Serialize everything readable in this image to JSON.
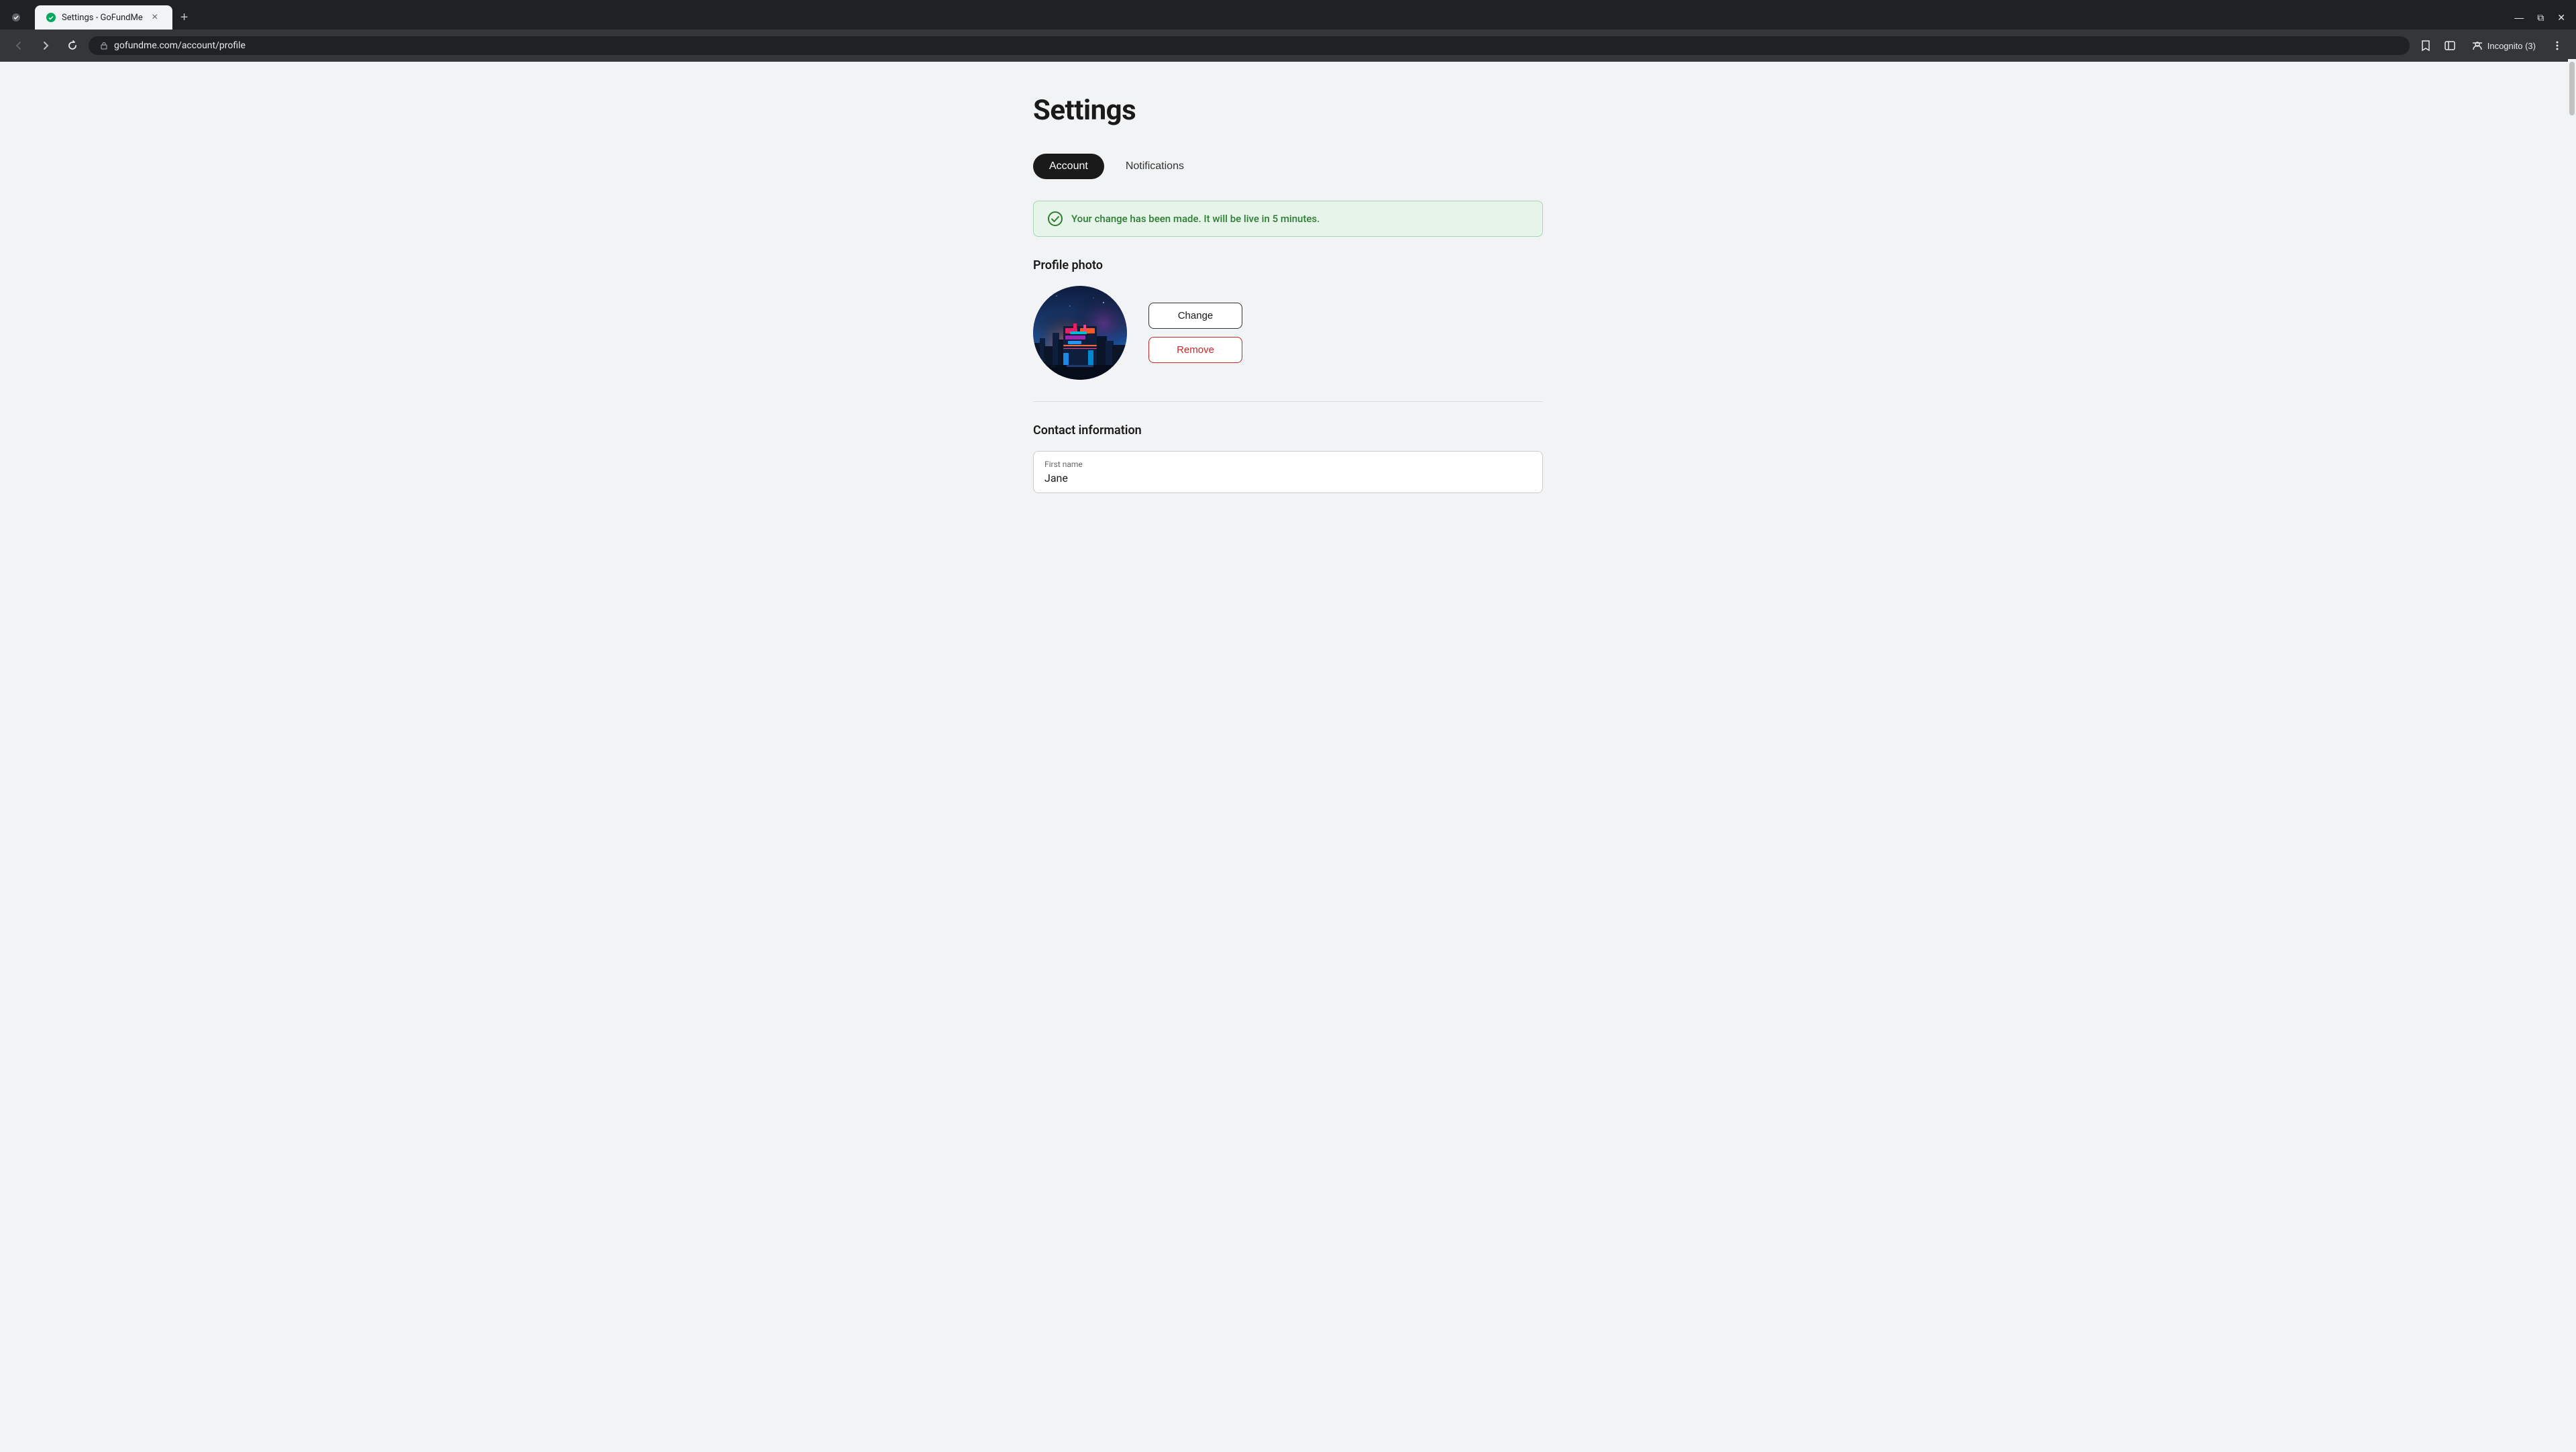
{
  "browser": {
    "tab": {
      "title": "Settings - GoFundMe",
      "favicon": "gfm"
    },
    "new_tab_label": "+",
    "address_bar": {
      "url": "gofundme.com/account/profile"
    },
    "incognito": {
      "label": "Incognito (3)"
    },
    "nav": {
      "back_label": "←",
      "forward_label": "→",
      "reload_label": "↻"
    }
  },
  "page": {
    "title": "Settings",
    "tabs": [
      {
        "label": "Account",
        "active": true
      },
      {
        "label": "Notifications",
        "active": false
      }
    ],
    "success_message": "Your change has been made. It will be live in 5 minutes.",
    "profile_photo": {
      "section_title": "Profile photo",
      "change_label": "Change",
      "remove_label": "Remove"
    },
    "contact_information": {
      "section_title": "Contact information",
      "first_name_label": "First name",
      "first_name_value": "Jane"
    }
  },
  "colors": {
    "active_tab_bg": "#1a1a1a",
    "active_tab_text": "#ffffff",
    "success_bg": "#e6f4ea",
    "success_border": "#a8d5b5",
    "success_text": "#2e7d32",
    "remove_color": "#c62828"
  }
}
